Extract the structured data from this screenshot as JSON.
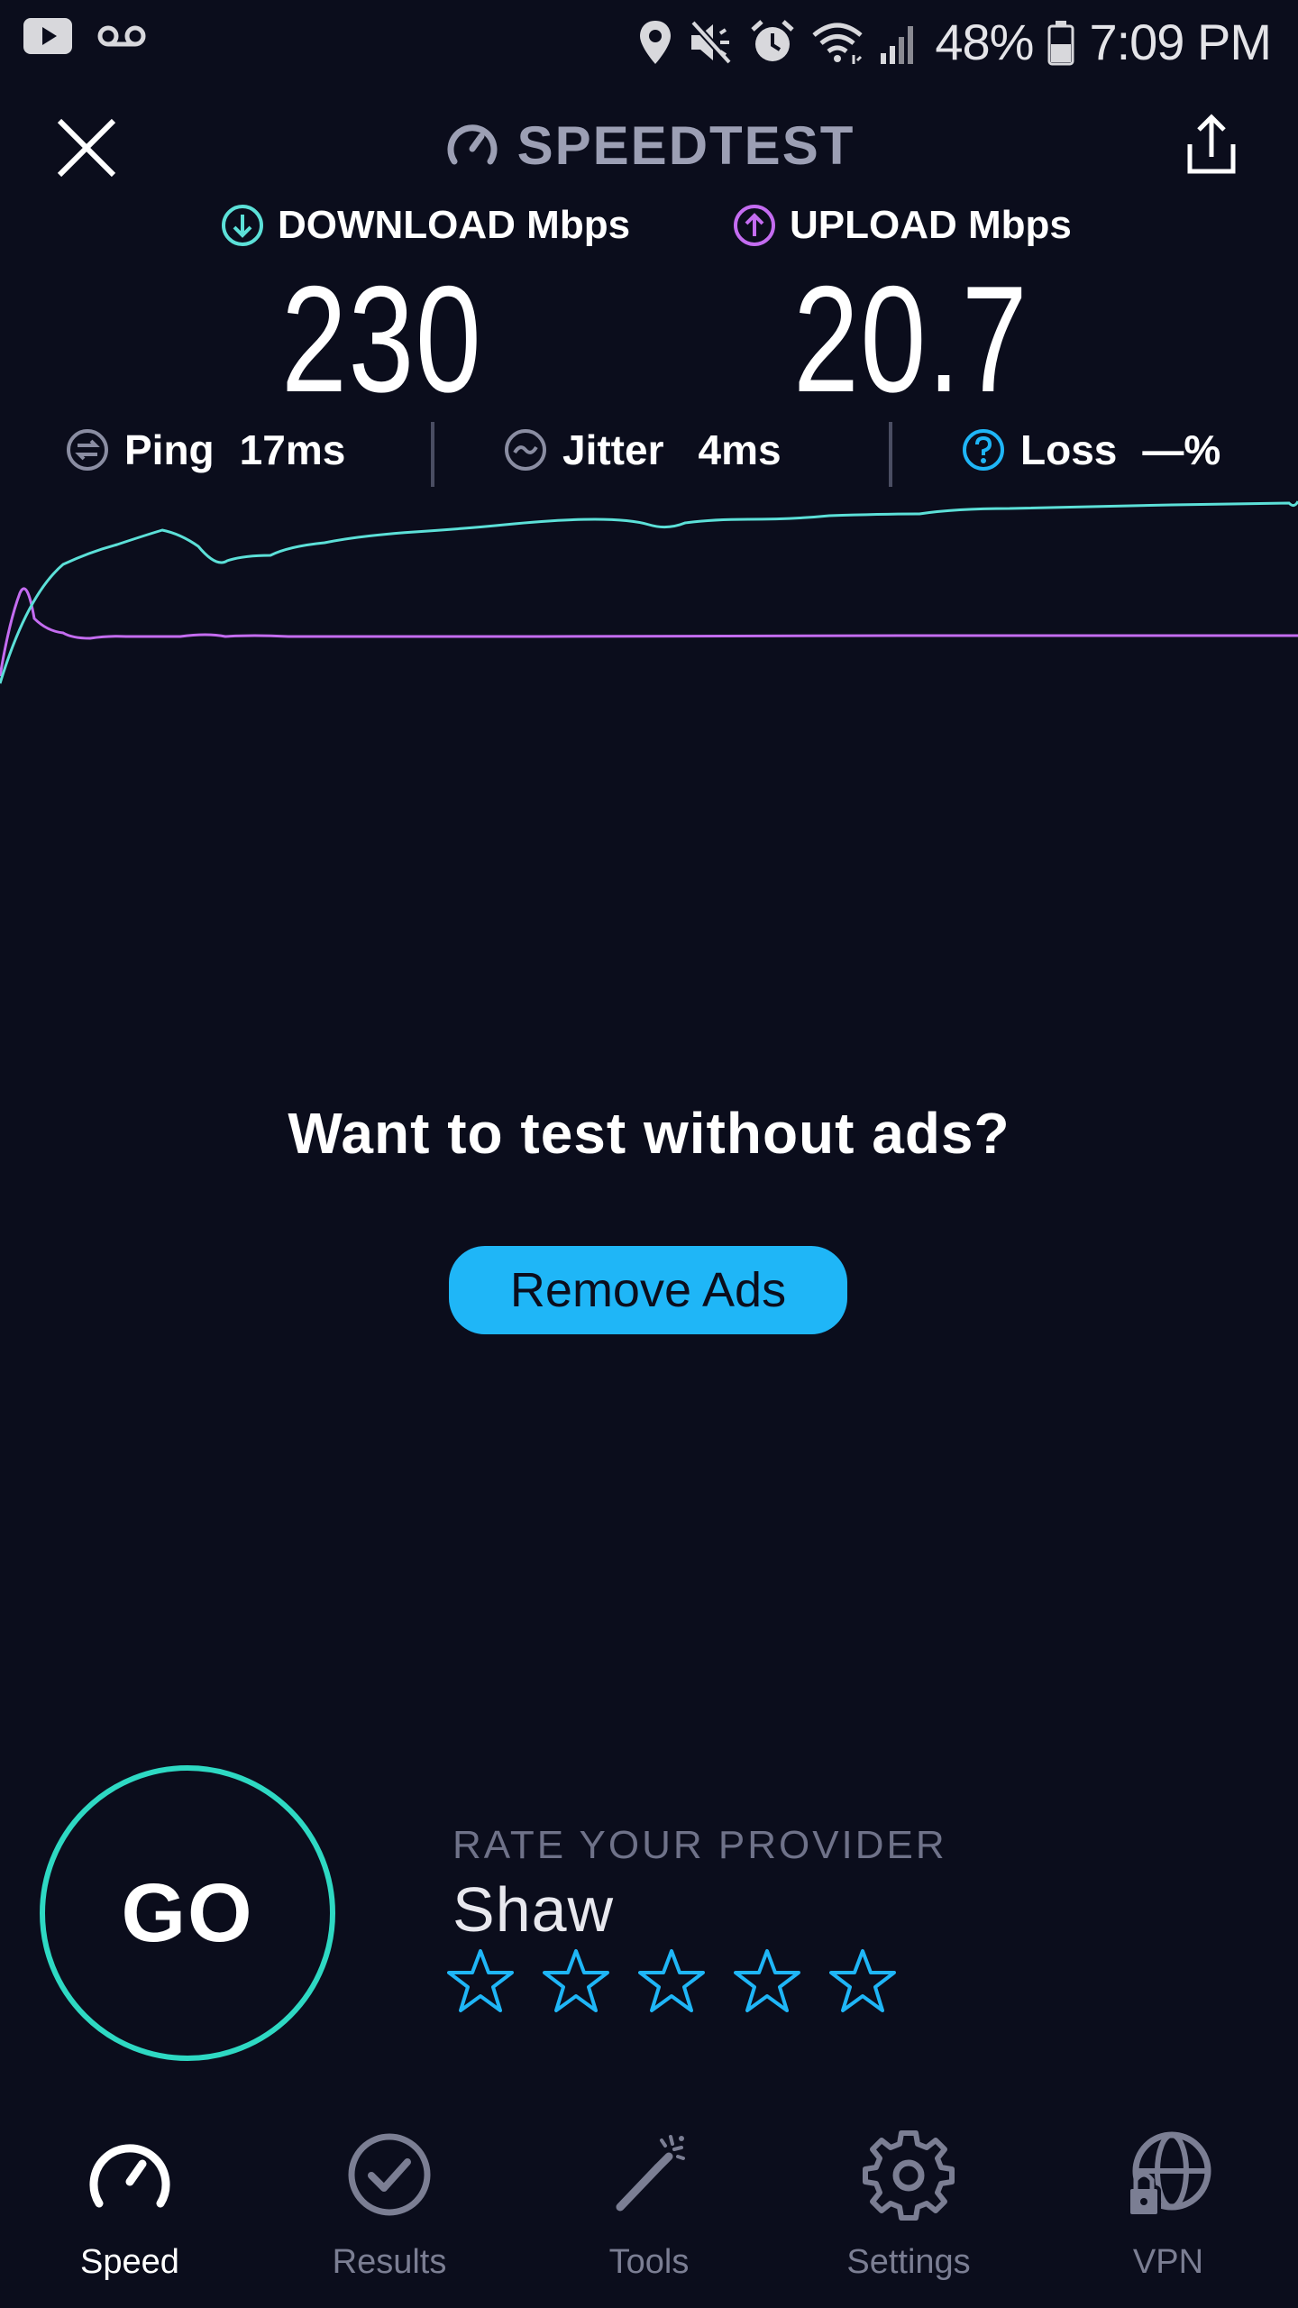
{
  "status_bar": {
    "battery": "48%",
    "time": "7:09 PM",
    "icons": [
      "youtube-icon",
      "voicemail-icon",
      "location-icon",
      "mute-icon",
      "alarm-icon",
      "wifi-icon",
      "signal-icon",
      "battery-icon"
    ]
  },
  "header": {
    "title": "SPEEDTEST",
    "icons": [
      "close-icon",
      "speedtest-logo-icon",
      "share-icon"
    ]
  },
  "results": {
    "download_label": "DOWNLOAD Mbps",
    "download_value": "230",
    "upload_label": "UPLOAD Mbps",
    "upload_value": "20.7"
  },
  "stats": {
    "ping_label": "Ping",
    "ping_value": "17ms",
    "jitter_label": "Jitter",
    "jitter_value": "4ms",
    "loss_label": "Loss",
    "loss_value": "—%"
  },
  "promo": {
    "title": "Want to test without ads?",
    "button": "Remove Ads"
  },
  "go_button": "GO",
  "rating": {
    "label": "RATE YOUR PROVIDER",
    "provider": "Shaw",
    "stars_filled": 0,
    "stars_total": 5
  },
  "tabs": [
    {
      "label": "Speed",
      "icon": "speed-icon",
      "active": true
    },
    {
      "label": "Results",
      "icon": "results-icon",
      "active": false
    },
    {
      "label": "Tools",
      "icon": "tools-icon",
      "active": false
    },
    {
      "label": "Settings",
      "icon": "settings-icon",
      "active": false
    },
    {
      "label": "VPN",
      "icon": "vpn-icon",
      "active": false
    }
  ],
  "colors": {
    "background": "#0b0d1c",
    "download": "#5ce0d8",
    "upload": "#c46cf0",
    "accent": "#1fb6f7",
    "go_ring": "#2ed9c3"
  }
}
